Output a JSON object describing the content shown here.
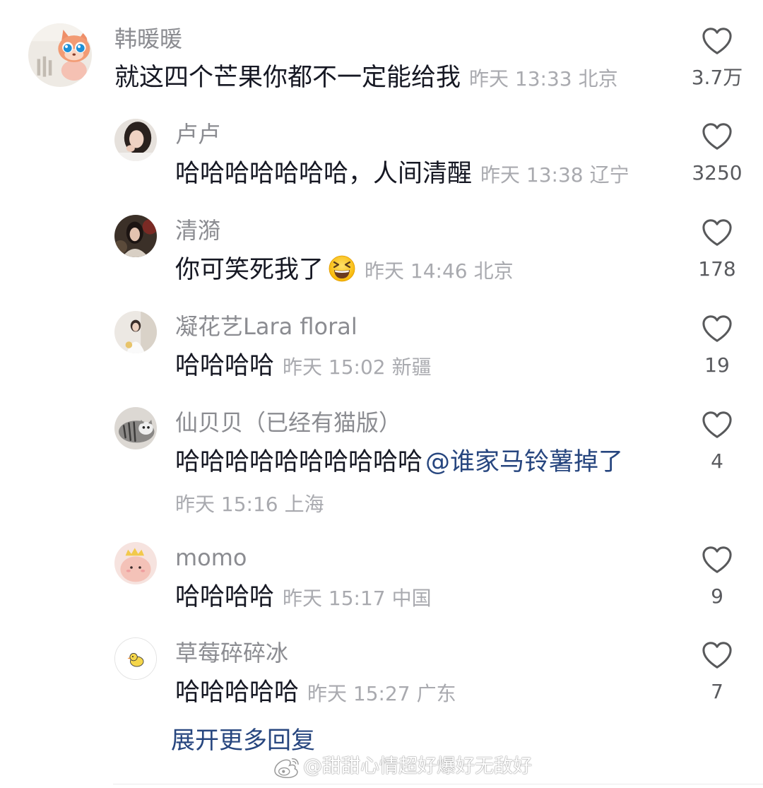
{
  "colors": {
    "background": "#ffffff",
    "text": "#161823",
    "username": "#8b8c91",
    "meta": "#a9aaaf",
    "like_count": "#595a5e",
    "link": "#27467f"
  },
  "icons": {
    "like": "heart-outline-icon",
    "emoji": "laughing-face-emoji-icon",
    "watermark_logo": "weibo-logo-icon"
  },
  "comment": {
    "username": "韩暖暖",
    "text": "就这四个芒果你都不一定能给我",
    "time": "昨天 13:33",
    "location": "北京",
    "likes": "3.7万"
  },
  "replies": [
    {
      "username": "卢卢",
      "text": "哈哈哈哈哈哈哈，人间清醒",
      "time": "昨天 13:38",
      "location": "辽宁",
      "likes": "3250"
    },
    {
      "username": "清漪",
      "text": "你可笑死我了",
      "time": "昨天 14:46",
      "location": "北京",
      "likes": "178"
    },
    {
      "username": "凝花艺Lara floral",
      "text": "哈哈哈哈",
      "time": "昨天 15:02",
      "location": "新疆",
      "likes": "19"
    },
    {
      "username": "仙贝贝（已经有猫版）",
      "text": "哈哈哈哈哈哈哈哈哈哈",
      "mention": "@谁家马铃薯掉了",
      "time": "昨天 15:16",
      "location": "上海",
      "likes": "4"
    },
    {
      "username": "momo",
      "text": "哈哈哈哈",
      "time": "昨天 15:17",
      "location": "中国",
      "likes": "9"
    },
    {
      "username": "草莓碎碎冰",
      "text": "哈哈哈哈哈",
      "time": "昨天 15:27",
      "location": "广东",
      "likes": "7"
    }
  ],
  "expand_more_label": "展开更多回复",
  "watermark": {
    "text": "@甜甜心情超好爆好无敌好"
  }
}
